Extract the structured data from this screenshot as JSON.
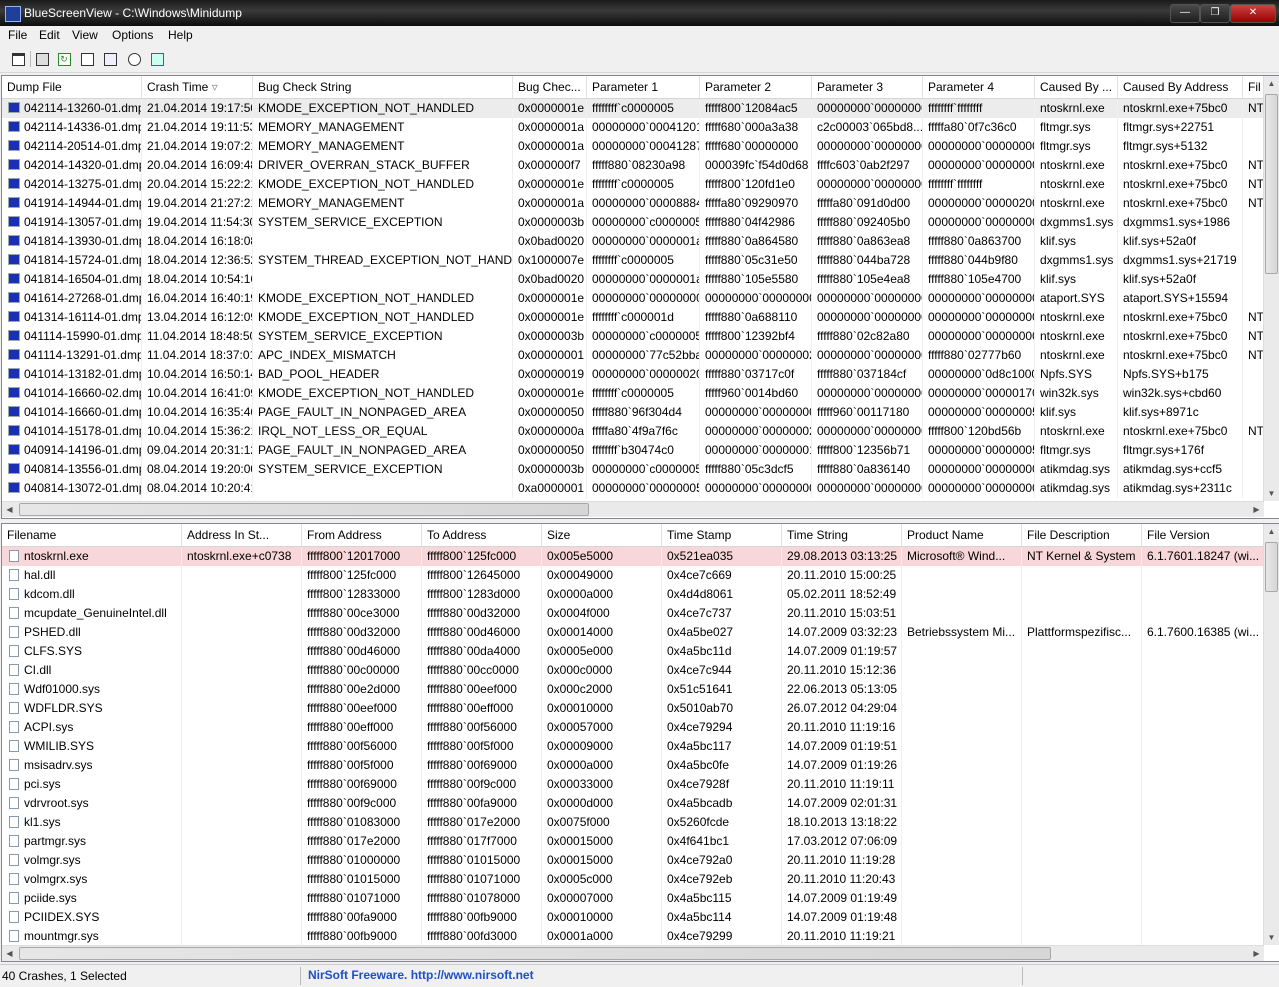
{
  "window": {
    "title": "BlueScreenView  -  C:\\Windows\\Minidump"
  },
  "menu": [
    "File",
    "Edit",
    "View",
    "Options",
    "Help"
  ],
  "toolbar": [
    {
      "icon": "properties-icon"
    },
    {
      "icon": "save-icon"
    },
    {
      "icon": "refresh-icon"
    },
    {
      "icon": "copy-icon"
    },
    {
      "icon": "options-icon"
    },
    {
      "icon": "find-icon"
    },
    {
      "icon": "exit-icon"
    }
  ],
  "crash_table": {
    "columns": [
      "Dump File",
      "Crash Time",
      "Bug Check String",
      "Bug Chec...",
      "Parameter 1",
      "Parameter 2",
      "Parameter 3",
      "Parameter 4",
      "Caused By ...",
      "Caused By Address",
      "Fil"
    ],
    "rows": [
      [
        "042114-13260-01.dmp",
        "21.04.2014 19:17:50",
        "KMODE_EXCEPTION_NOT_HANDLED",
        "0x0000001e",
        "ffffffff`c0000005",
        "fffff800`12084ac5",
        "00000000`00000000",
        "ffffffff`ffffffff",
        "ntoskrnl.exe",
        "ntoskrnl.exe+75bc0",
        "NT"
      ],
      [
        "042114-14336-01.dmp",
        "21.04.2014 19:11:53",
        "MEMORY_MANAGEMENT",
        "0x0000001a",
        "00000000`00041201",
        "fffff680`000a3a38",
        "c2c00003`065bd8...",
        "fffffa80`0f7c36c0",
        "fltmgr.sys",
        "fltmgr.sys+22751",
        ""
      ],
      [
        "042114-20514-01.dmp",
        "21.04.2014 19:07:21",
        "MEMORY_MANAGEMENT",
        "0x0000001a",
        "00000000`00041287",
        "fffff680`00000000",
        "00000000`00000000",
        "00000000`00000000",
        "fltmgr.sys",
        "fltmgr.sys+5132",
        ""
      ],
      [
        "042014-14320-01.dmp",
        "20.04.2014 16:09:48",
        "DRIVER_OVERRAN_STACK_BUFFER",
        "0x000000f7",
        "fffff880`08230a98",
        "000039fc`f54d0d68",
        "ffffc603`0ab2f297",
        "00000000`00000000",
        "ntoskrnl.exe",
        "ntoskrnl.exe+75bc0",
        "NT"
      ],
      [
        "042014-13275-01.dmp",
        "20.04.2014 15:22:21",
        "KMODE_EXCEPTION_NOT_HANDLED",
        "0x0000001e",
        "ffffffff`c0000005",
        "fffff800`120fd1e0",
        "00000000`00000000",
        "ffffffff`ffffffff",
        "ntoskrnl.exe",
        "ntoskrnl.exe+75bc0",
        "NT"
      ],
      [
        "041914-14944-01.dmp",
        "19.04.2014 21:27:21",
        "MEMORY_MANAGEMENT",
        "0x0000001a",
        "00000000`00008884",
        "fffffa80`09290970",
        "fffffa80`091d0d00",
        "00000000`00000200",
        "ntoskrnl.exe",
        "ntoskrnl.exe+75bc0",
        "NT"
      ],
      [
        "041914-13057-01.dmp",
        "19.04.2014 11:54:30",
        "SYSTEM_SERVICE_EXCEPTION",
        "0x0000003b",
        "00000000`c0000005",
        "fffff880`04f42986",
        "fffff880`092405b0",
        "00000000`00000000",
        "dxgmms1.sys",
        "dxgmms1.sys+1986",
        ""
      ],
      [
        "041814-13930-01.dmp",
        "18.04.2014 16:18:08",
        "",
        "0x0bad0020",
        "00000000`0000001a",
        "fffff880`0a864580",
        "fffff880`0a863ea8",
        "fffff880`0a863700",
        "klif.sys",
        "klif.sys+52a0f",
        ""
      ],
      [
        "041814-15724-01.dmp",
        "18.04.2014 12:36:52",
        "SYSTEM_THREAD_EXCEPTION_NOT_HANDLED",
        "0x1000007e",
        "ffffffff`c0000005",
        "fffff880`05c31e50",
        "fffff880`044ba728",
        "fffff880`044b9f80",
        "dxgmms1.sys",
        "dxgmms1.sys+21719",
        ""
      ],
      [
        "041814-16504-01.dmp",
        "18.04.2014 10:54:16",
        "",
        "0x0bad0020",
        "00000000`0000001a",
        "fffff880`105e5580",
        "fffff880`105e4ea8",
        "fffff880`105e4700",
        "klif.sys",
        "klif.sys+52a0f",
        ""
      ],
      [
        "041614-27268-01.dmp",
        "16.04.2014 16:40:19",
        "KMODE_EXCEPTION_NOT_HANDLED",
        "0x0000001e",
        "00000000`00000000",
        "00000000`00000000",
        "00000000`00000000",
        "00000000`00000000",
        "ataport.SYS",
        "ataport.SYS+15594",
        ""
      ],
      [
        "041314-16114-01.dmp",
        "13.04.2014 16:12:09",
        "KMODE_EXCEPTION_NOT_HANDLED",
        "0x0000001e",
        "ffffffff`c000001d",
        "fffff880`0a688110",
        "00000000`00000000",
        "00000000`00000000",
        "ntoskrnl.exe",
        "ntoskrnl.exe+75bc0",
        "NT"
      ],
      [
        "041114-15990-01.dmp",
        "11.04.2014 18:48:50",
        "SYSTEM_SERVICE_EXCEPTION",
        "0x0000003b",
        "00000000`c0000005",
        "fffff800`12392bf4",
        "fffff880`02c82a80",
        "00000000`00000000",
        "ntoskrnl.exe",
        "ntoskrnl.exe+75bc0",
        "NT"
      ],
      [
        "041114-13291-01.dmp",
        "11.04.2014 18:37:01",
        "APC_INDEX_MISMATCH",
        "0x00000001",
        "00000000`77c52bba",
        "00000000`00000002",
        "00000000`00000000",
        "fffff880`02777b60",
        "ntoskrnl.exe",
        "ntoskrnl.exe+75bc0",
        "NT"
      ],
      [
        "041014-13182-01.dmp",
        "10.04.2014 16:50:14",
        "BAD_POOL_HEADER",
        "0x00000019",
        "00000000`00000020",
        "fffff880`03717c0f",
        "fffff880`037184cf",
        "00000000`0d8c1000",
        "Npfs.SYS",
        "Npfs.SYS+b175",
        ""
      ],
      [
        "041014-16660-02.dmp",
        "10.04.2014 16:41:09",
        "KMODE_EXCEPTION_NOT_HANDLED",
        "0x0000001e",
        "ffffffff`c0000005",
        "fffff960`0014bd60",
        "00000000`00000000",
        "00000000`00000170",
        "win32k.sys",
        "win32k.sys+cbd60",
        ""
      ],
      [
        "041014-16660-01.dmp",
        "10.04.2014 16:35:46",
        "PAGE_FAULT_IN_NONPAGED_AREA",
        "0x00000050",
        "fffff880`96f304d4",
        "00000000`00000000",
        "fffff960`00117180",
        "00000000`00000005",
        "klif.sys",
        "klif.sys+8971c",
        ""
      ],
      [
        "041014-15178-01.dmp",
        "10.04.2014 15:36:21",
        "IRQL_NOT_LESS_OR_EQUAL",
        "0x0000000a",
        "fffffa80`4f9a7f6c",
        "00000000`00000002",
        "00000000`00000000",
        "fffff800`120bd56b",
        "ntoskrnl.exe",
        "ntoskrnl.exe+75bc0",
        "NT"
      ],
      [
        "040914-14196-01.dmp",
        "09.04.2014 20:31:12",
        "PAGE_FAULT_IN_NONPAGED_AREA",
        "0x00000050",
        "ffffffff`b30474c0",
        "00000000`00000001",
        "fffff800`12356b71",
        "00000000`00000005",
        "fltmgr.sys",
        "fltmgr.sys+176f",
        ""
      ],
      [
        "040814-13556-01.dmp",
        "08.04.2014 19:20:00",
        "SYSTEM_SERVICE_EXCEPTION",
        "0x0000003b",
        "00000000`c0000005",
        "fffff880`05c3dcf5",
        "fffff880`0a836140",
        "00000000`00000000",
        "atikmdag.sys",
        "atikmdag.sys+ccf5",
        ""
      ],
      [
        "040814-13072-01.dmp",
        "08.04.2014 10:20:41",
        "",
        "0xa0000001",
        "00000000`00000005",
        "00000000`00000000",
        "00000000`00000000",
        "00000000`00000000",
        "atikmdag.sys",
        "atikmdag.sys+2311c",
        ""
      ]
    ]
  },
  "driver_table": {
    "columns": [
      "Filename",
      "Address In St...",
      "From Address",
      "To Address",
      "Size",
      "Time Stamp",
      "Time String",
      "Product Name",
      "File Description",
      "File Version"
    ],
    "rows": [
      [
        "ntoskrnl.exe",
        "ntoskrnl.exe+c0738",
        "fffff800`12017000",
        "fffff800`125fc000",
        "0x005e5000",
        "0x521ea035",
        "29.08.2013 03:13:25",
        "Microsoft® Wind...",
        "NT Kernel & System",
        "6.1.7601.18247 (wi..."
      ],
      [
        "hal.dll",
        "",
        "fffff800`125fc000",
        "fffff800`12645000",
        "0x00049000",
        "0x4ce7c669",
        "20.11.2010 15:00:25",
        "",
        "",
        ""
      ],
      [
        "kdcom.dll",
        "",
        "fffff800`12833000",
        "fffff800`1283d000",
        "0x0000a000",
        "0x4d4d8061",
        "05.02.2011 18:52:49",
        "",
        "",
        ""
      ],
      [
        "mcupdate_GenuineIntel.dll",
        "",
        "fffff880`00ce3000",
        "fffff880`00d32000",
        "0x0004f000",
        "0x4ce7c737",
        "20.11.2010 15:03:51",
        "",
        "",
        ""
      ],
      [
        "PSHED.dll",
        "",
        "fffff880`00d32000",
        "fffff880`00d46000",
        "0x00014000",
        "0x4a5be027",
        "14.07.2009 03:32:23",
        "Betriebssystem Mi...",
        "Plattformspezifisc...",
        "6.1.7600.16385 (wi..."
      ],
      [
        "CLFS.SYS",
        "",
        "fffff880`00d46000",
        "fffff880`00da4000",
        "0x0005e000",
        "0x4a5bc11d",
        "14.07.2009 01:19:57",
        "",
        "",
        ""
      ],
      [
        "CI.dll",
        "",
        "fffff880`00c00000",
        "fffff880`00cc0000",
        "0x000c0000",
        "0x4ce7c944",
        "20.11.2010 15:12:36",
        "",
        "",
        ""
      ],
      [
        "Wdf01000.sys",
        "",
        "fffff880`00e2d000",
        "fffff880`00eef000",
        "0x000c2000",
        "0x51c51641",
        "22.06.2013 05:13:05",
        "",
        "",
        ""
      ],
      [
        "WDFLDR.SYS",
        "",
        "fffff880`00eef000",
        "fffff880`00eff000",
        "0x00010000",
        "0x5010ab70",
        "26.07.2012 04:29:04",
        "",
        "",
        ""
      ],
      [
        "ACPI.sys",
        "",
        "fffff880`00eff000",
        "fffff880`00f56000",
        "0x00057000",
        "0x4ce79294",
        "20.11.2010 11:19:16",
        "",
        "",
        ""
      ],
      [
        "WMILIB.SYS",
        "",
        "fffff880`00f56000",
        "fffff880`00f5f000",
        "0x00009000",
        "0x4a5bc117",
        "14.07.2009 01:19:51",
        "",
        "",
        ""
      ],
      [
        "msisadrv.sys",
        "",
        "fffff880`00f5f000",
        "fffff880`00f69000",
        "0x0000a000",
        "0x4a5bc0fe",
        "14.07.2009 01:19:26",
        "",
        "",
        ""
      ],
      [
        "pci.sys",
        "",
        "fffff880`00f69000",
        "fffff880`00f9c000",
        "0x00033000",
        "0x4ce7928f",
        "20.11.2010 11:19:11",
        "",
        "",
        ""
      ],
      [
        "vdrvroot.sys",
        "",
        "fffff880`00f9c000",
        "fffff880`00fa9000",
        "0x0000d000",
        "0x4a5bcadb",
        "14.07.2009 02:01:31",
        "",
        "",
        ""
      ],
      [
        "kl1.sys",
        "",
        "fffff880`01083000",
        "fffff880`017e2000",
        "0x0075f000",
        "0x5260fcde",
        "18.10.2013 13:18:22",
        "",
        "",
        ""
      ],
      [
        "partmgr.sys",
        "",
        "fffff880`017e2000",
        "fffff880`017f7000",
        "0x00015000",
        "0x4f641bc1",
        "17.03.2012 07:06:09",
        "",
        "",
        ""
      ],
      [
        "volmgr.sys",
        "",
        "fffff880`01000000",
        "fffff880`01015000",
        "0x00015000",
        "0x4ce792a0",
        "20.11.2010 11:19:28",
        "",
        "",
        ""
      ],
      [
        "volmgrx.sys",
        "",
        "fffff880`01015000",
        "fffff880`01071000",
        "0x0005c000",
        "0x4ce792eb",
        "20.11.2010 11:20:43",
        "",
        "",
        ""
      ],
      [
        "pciide.sys",
        "",
        "fffff880`01071000",
        "fffff880`01078000",
        "0x00007000",
        "0x4a5bc115",
        "14.07.2009 01:19:49",
        "",
        "",
        ""
      ],
      [
        "PCIIDEX.SYS",
        "",
        "fffff880`00fa9000",
        "fffff880`00fb9000",
        "0x00010000",
        "0x4a5bc114",
        "14.07.2009 01:19:48",
        "",
        "",
        ""
      ],
      [
        "mountmgr.sys",
        "",
        "fffff880`00fb9000",
        "fffff880`00fd3000",
        "0x0001a000",
        "0x4ce79299",
        "20.11.2010 11:19:21",
        "",
        "",
        ""
      ]
    ]
  },
  "status": {
    "count": "40 Crashes, 1 Selected",
    "link": "NirSoft Freeware.  http://www.nirsoft.net"
  }
}
